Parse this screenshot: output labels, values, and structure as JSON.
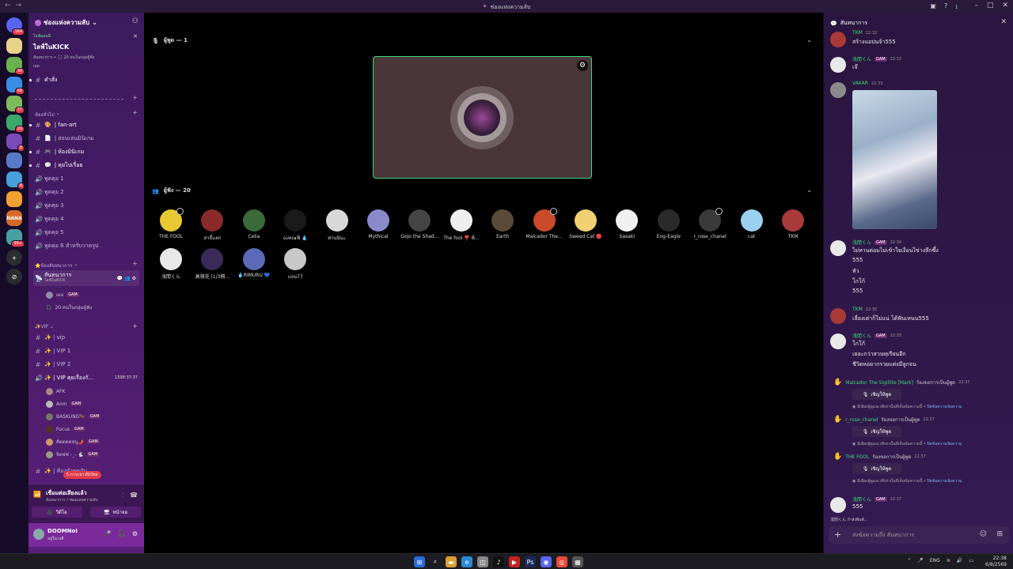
{
  "window": {
    "title": "ช่องแห่งความลับ",
    "title_icon": "voice-channel-icon"
  },
  "rail": {
    "servers": [
      {
        "icon": "discord-home-icon",
        "badge": "164",
        "color": "#5865f2"
      },
      {
        "icon": "server-1",
        "badge": "",
        "color": "#e8d28a"
      },
      {
        "icon": "server-2",
        "badge": "30",
        "color": "#6ab04c"
      },
      {
        "icon": "server-3",
        "badge": "46",
        "color": "#3a8ee6"
      },
      {
        "icon": "server-4",
        "badge": "77",
        "color": "#7cba5a"
      },
      {
        "icon": "server-5",
        "badge": "20",
        "color": "#3aa86e"
      },
      {
        "icon": "server-6",
        "badge": "8",
        "color": "#7a4ab8"
      },
      {
        "icon": "server-7",
        "badge": "",
        "color": "#5a7ac8"
      },
      {
        "icon": "server-8",
        "badge": "8",
        "color": "#4aa0d8"
      },
      {
        "icon": "server-9",
        "badge": "",
        "color": "#f0a030"
      },
      {
        "icon": "server-10",
        "badge": "",
        "color": "#d46a2a",
        "label": "NANA"
      },
      {
        "icon": "server-11",
        "badge": "99+",
        "color": "#4aa0a0"
      }
    ]
  },
  "sidebar": {
    "server_name": "ช่องแห่งความลับ",
    "event": {
      "live": "ไลฟ์ออนนี่",
      "title": "ไลฟ์ในKICK",
      "sub": "สันทนาการ • 🎧 20 คนในกลุ่มผู้ฟัง",
      "sub2": "เผล"
    },
    "channels_top": [
      {
        "label": "คำสั่ง",
        "icon": "text-channel-icon"
      }
    ],
    "divider_label": "----------------------------------------",
    "category_general": "ห้องทั่วไป",
    "channels_general": [
      {
        "label": "| fan-art",
        "emoji": "🎨"
      },
      {
        "label": "| สอนเล่นมินิเกม",
        "emoji": "📄"
      },
      {
        "label": "| ห้องมินิเกม",
        "emoji": "🎮"
      },
      {
        "label": "| คุยไปเรื่อย",
        "emoji": "💬"
      }
    ],
    "voice_rooms": [
      "พูดคุย 1",
      "พูดคุย 2",
      "พูดคุย 3",
      "พูดคุย 4",
      "พูดคุย 5",
      "พูดคุย 6 สำหรับวาดรูป"
    ],
    "category_rec": "⭐ห้องสันทนาการ",
    "stage_channel": {
      "label": "สันทนาการ",
      "sub": "ไลฟ์ในKICK"
    },
    "stage_users": [
      {
        "name": "เผล",
        "tag": "GAM"
      },
      {
        "name": "20 คนในกลุ่มผู้ฟัง",
        "tag": ""
      }
    ],
    "category_vip": "✨VIP",
    "vip_channels": [
      "✨ | vip",
      "✨ | VIP 1",
      "✨ | VIP 2",
      "✨ | VIP คุยเรื่องกั..."
    ],
    "vip_timer": "1598:37:37",
    "vip_users": [
      {
        "name": "AFK",
        "tag": ""
      },
      {
        "name": "Aom",
        "tag": "GAM"
      },
      {
        "name": "BASKUNG🐂",
        "tag": "GAM"
      },
      {
        "name": "Focus",
        "tag": "GAM"
      },
      {
        "name": "คิดดดดหนู🌶️",
        "tag": "GAM"
      },
      {
        "name": "จิตฟฟ -_- 🐇",
        "tag": "GAM"
      }
    ],
    "last_channel": "✨ | ห้องลำพุดกับ",
    "notify": "5 การกล่าวถึงใหม่"
  },
  "voice_panel": {
    "status": "เชื่อมต่อเสียงแล้ว",
    "location": "สันทนาการ / ช่องแห่งความลับ",
    "video_label": "วิดีโอ",
    "screen_label": "หน้าจอ"
  },
  "user_panel": {
    "name": "DOOMNoI",
    "status": "อยู่ในวงที่"
  },
  "stage": {
    "speakers_label": "ผู้พูด — 1",
    "audience_label": "ผู้ฟัง — 20",
    "audience": [
      {
        "name": "THE FOOL",
        "color": "#e8c830"
      },
      {
        "name": "สาธิ้แลก",
        "color": "#8a2a2a"
      },
      {
        "name": "Celia",
        "color": "#3a6a3a"
      },
      {
        "name": "ɢυʀɪ๑ฟี 💧",
        "color": "#1a1a1a"
      },
      {
        "name": "ท่านนินะ",
        "color": "#d8d8d8"
      },
      {
        "name": "Mythical",
        "color": "#8a8ac8"
      },
      {
        "name": "Gojo the Shad...",
        "color": "#444"
      },
      {
        "name": "The fool ❣️ พี่...",
        "color": "#eee"
      },
      {
        "name": "Earth",
        "color": "#5a4a3a"
      },
      {
        "name": "Malcador The...",
        "color": "#c84a2a"
      },
      {
        "name": "Sweed Cat 🔴",
        "color": "#f0d070"
      },
      {
        "name": "Sasaki",
        "color": "#f0f0f0"
      },
      {
        "name": "Eng-Eagle",
        "color": "#2a2a2a"
      },
      {
        "name": "r_rose_chanel",
        "color": "#3a3a3a"
      },
      {
        "name": "cat",
        "color": "#9ad0f0"
      },
      {
        "name": "TKM",
        "color": "#a83a3a"
      },
      {
        "name": "浅閒くん",
        "color": "#e8e8e8"
      },
      {
        "name": "高嶺花 (1/3冊...",
        "color": "#3a2a5a"
      },
      {
        "name": "💧RIMURU 💙",
        "color": "#5a6ab8"
      },
      {
        "name": "แจน77",
        "color": "#c8c8c8"
      }
    ]
  },
  "chat": {
    "title": "สันทนาการ",
    "messages": [
      {
        "author": "TKM",
        "time": "22:32",
        "tag": "",
        "lines": [
          "สร้างแอปนจ้า555"
        ],
        "color": "#a83a3a"
      },
      {
        "author": "浅閒くん",
        "time": "22:32",
        "tag": "GAM",
        "lines": [
          "เจ๊"
        ],
        "color": "#e8e8e8"
      },
      {
        "author": "VAKAR",
        "time": "22:33",
        "tag": "",
        "lines": [],
        "color": "#8a8a8a",
        "image": true
      },
      {
        "author": "浅閒くん",
        "time": "22:34",
        "tag": "GAM",
        "lines": [
          "ไม่ทานต่อมไม่เข้าใจเงื่อนไข่างลึกซึ้ง",
          "555",
          "หัว",
          "โกโก้",
          "555"
        ],
        "color": "#e8e8e8"
      },
      {
        "author": "TKM",
        "time": "22:35",
        "tag": "",
        "lines": [
          "เลื่องเต่าก็ไม่แน่ ได้ฟันเหนน555"
        ],
        "color": "#a83a3a"
      },
      {
        "author": "浅閒くん",
        "time": "22:35",
        "tag": "GAM",
        "lines": [
          "โกโก้",
          "เยอะกว่าสวนทุเรียนอีก",
          "ชีวิตหอยากรวยแต่งมีลูกจน"
        ],
        "color": "#e8e8e8"
      }
    ],
    "requests": [
      {
        "name": "Malcador The Sigillite [Mark]",
        "text": "ร้องขอการเป็นผู้พูด",
        "time": "22:37"
      },
      {
        "name": "r_rose_chanel",
        "text": "ร้องขอการเป็นผู้พูด",
        "time": "22:37"
      },
      {
        "name": "THE FOOL",
        "text": "ร้องขอการเป็นผู้พูด",
        "time": "22:37"
      }
    ],
    "invite_label": "เชิญให้พูด",
    "note": "มีเพียงผู้ดูแลเวทีเท่านั้นที่เห็นข้อความนี้ •",
    "note_link": "ปิดข้อความข้อความ",
    "last_msg": {
      "author": "浅閒くん",
      "time": "22:37",
      "tag": "GAM",
      "line": "555"
    },
    "typing": "浅閒くん กำลังพิมพ์...",
    "input_placeholder": "ส่งข้อความถึง สันทนาการ"
  },
  "taskbar": {
    "lang": "ENG",
    "time": "22:38",
    "date": "6/8/2569"
  }
}
